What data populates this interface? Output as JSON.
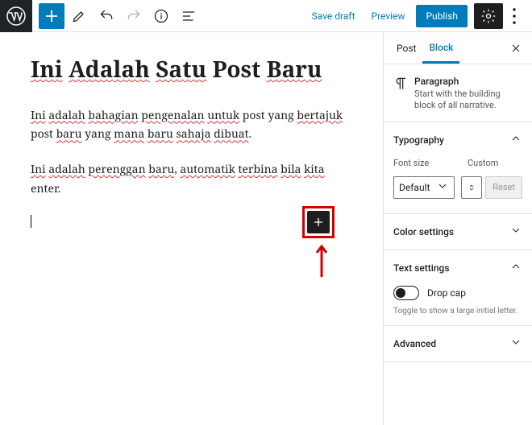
{
  "topbar": {
    "save_draft": "Save draft",
    "preview": "Preview",
    "publish": "Publish"
  },
  "post": {
    "title_parts": [
      {
        "t": "Ini",
        "s": true
      },
      {
        "t": " "
      },
      {
        "t": "Adalah",
        "s": true
      },
      {
        "t": " "
      },
      {
        "t": "Satu",
        "s": true
      },
      {
        "t": " Post "
      },
      {
        "t": "Baru",
        "s": true
      }
    ],
    "para1_parts": [
      {
        "t": "Ini",
        "s": true
      },
      {
        "t": " "
      },
      {
        "t": "adalah",
        "s": true
      },
      {
        "t": " "
      },
      {
        "t": "bahagian",
        "s": true
      },
      {
        "t": " "
      },
      {
        "t": "pengenalan",
        "s": true
      },
      {
        "t": " "
      },
      {
        "t": "untuk",
        "s": true
      },
      {
        "t": " post yang "
      },
      {
        "t": "bertajuk",
        "s": true
      },
      {
        "t": " post "
      },
      {
        "t": "baru",
        "s": true
      },
      {
        "t": " yang "
      },
      {
        "t": "mana",
        "s": true
      },
      {
        "t": " "
      },
      {
        "t": "baru",
        "s": true
      },
      {
        "t": " "
      },
      {
        "t": "sahaja",
        "s": true
      },
      {
        "t": " "
      },
      {
        "t": "dibuat",
        "s": true
      },
      {
        "t": "."
      }
    ],
    "para2_parts": [
      {
        "t": "Ini",
        "s": true
      },
      {
        "t": " "
      },
      {
        "t": "adalah",
        "s": true
      },
      {
        "t": " "
      },
      {
        "t": "perenggan",
        "s": true
      },
      {
        "t": " "
      },
      {
        "t": "baru",
        "s": true
      },
      {
        "t": ", "
      },
      {
        "t": "automatik",
        "s": true
      },
      {
        "t": " "
      },
      {
        "t": "terbina",
        "s": true
      },
      {
        "t": " "
      },
      {
        "t": "bila",
        "s": true
      },
      {
        "t": " "
      },
      {
        "t": "kita",
        "s": true
      },
      {
        "t": " enter."
      }
    ]
  },
  "sidebar": {
    "tabs": {
      "post": "Post",
      "block": "Block"
    },
    "block_name": "Paragraph",
    "block_desc": "Start with the building block of all narrative.",
    "typography": {
      "title": "Typography",
      "font_size_label": "Font size",
      "custom_label": "Custom",
      "select_value": "Default",
      "reset": "Reset"
    },
    "color": {
      "title": "Color settings"
    },
    "text": {
      "title": "Text settings",
      "drop_cap": "Drop cap",
      "hint": "Toggle to show a large initial letter."
    },
    "advanced": {
      "title": "Advanced"
    }
  }
}
